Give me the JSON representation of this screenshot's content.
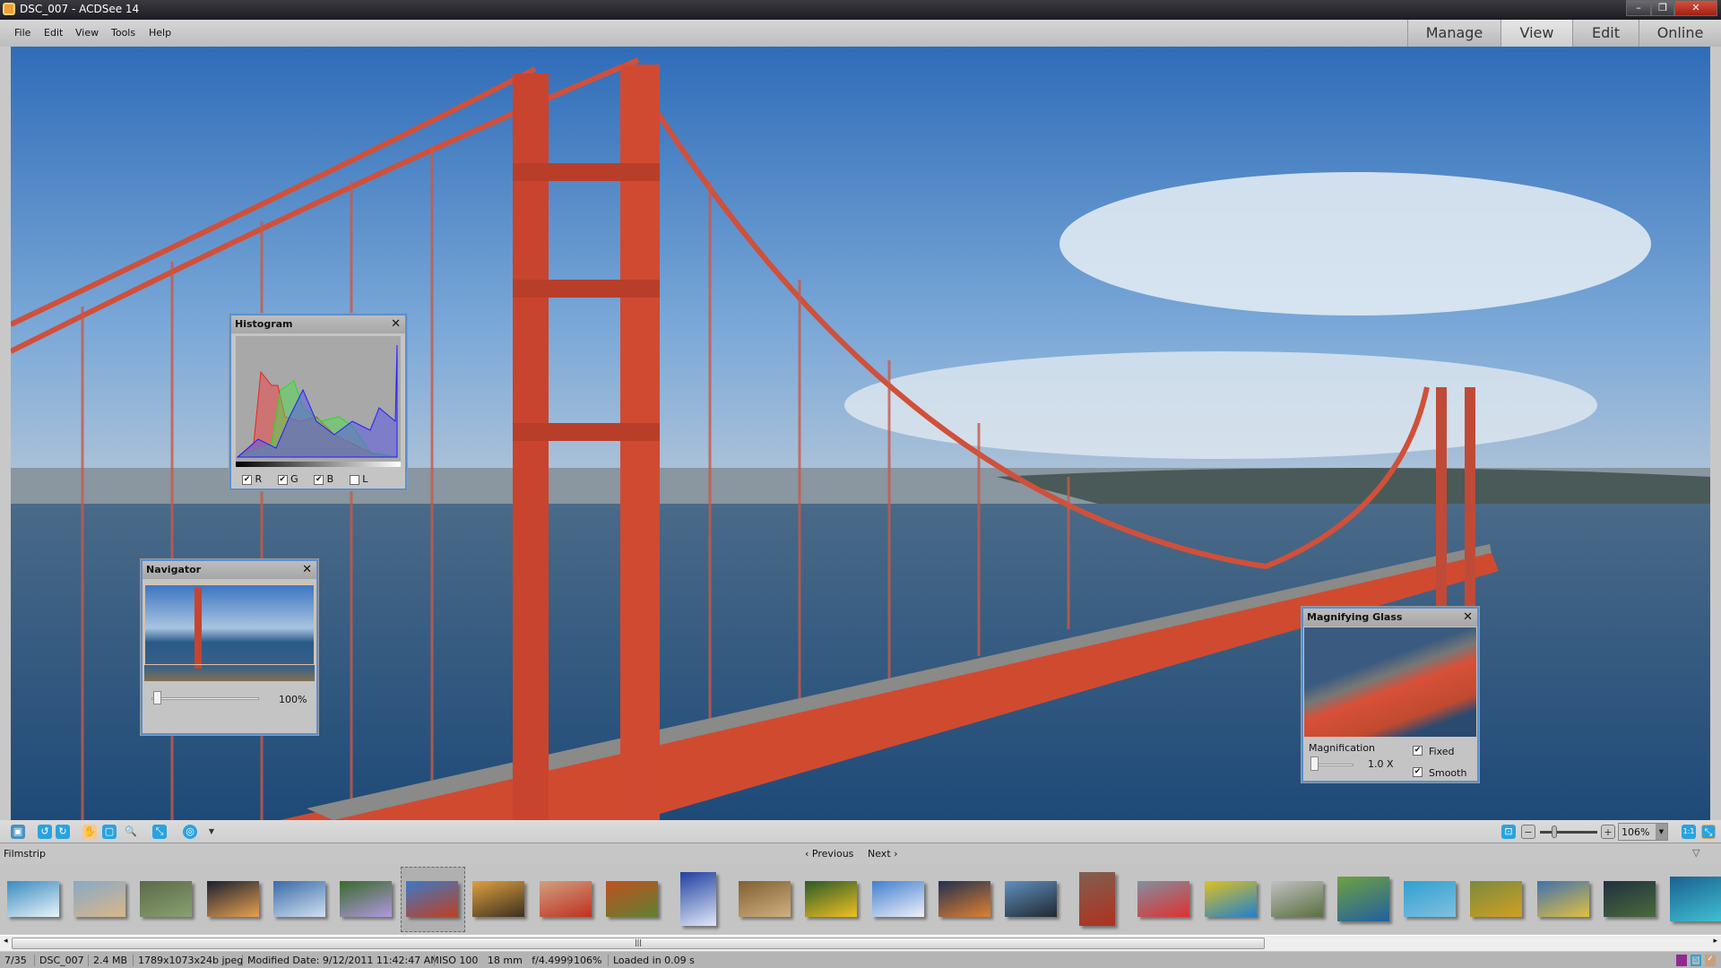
{
  "window": {
    "title": "DSC_007 - ACDSee 14",
    "minimize": "–",
    "maximize": "❐",
    "close": "✕"
  },
  "menu": [
    "File",
    "Edit",
    "View",
    "Tools",
    "Help"
  ],
  "modes": [
    {
      "label": "Manage",
      "active": false
    },
    {
      "label": "View",
      "active": true
    },
    {
      "label": "Edit",
      "active": false
    },
    {
      "label": "Online",
      "active": false
    }
  ],
  "histogram": {
    "title": "Histogram",
    "close": "✕",
    "channels": [
      {
        "label": "R",
        "checked": true,
        "color": "#ff3030"
      },
      {
        "label": "G",
        "checked": true,
        "color": "#30e030"
      },
      {
        "label": "B",
        "checked": true,
        "color": "#2020ff"
      },
      {
        "label": "L",
        "checked": false
      }
    ]
  },
  "navigator": {
    "title": "Navigator",
    "close": "✕",
    "zoom": "100%"
  },
  "magnifier": {
    "title": "Magnifying Glass",
    "close": "✕",
    "magnification_label": "Magnification",
    "value": "1.0  X",
    "fixed_label": "Fixed",
    "fixed": true,
    "smooth_label": "Smooth",
    "smooth": true
  },
  "toolbar": {
    "zoom_value": "106%",
    "actual_size": "1:1"
  },
  "filmstrip": {
    "label": "Filmstrip",
    "previous": "Previous",
    "next": "Next",
    "selected_index": 6,
    "thumb_colors": [
      [
        "#3a8ac0",
        "#e8f4f8"
      ],
      [
        "#88a8c8",
        "#d8b888"
      ],
      [
        "#5a6a4a",
        "#8aa070"
      ],
      [
        "#1a2030",
        "#e8a050"
      ],
      [
        "#3a6aa8",
        "#d0e0f0"
      ],
      [
        "#3a6a2a",
        "#b098e0"
      ],
      [
        "#3a7ac8",
        "#c04020"
      ],
      [
        "#e0a040",
        "#3a3020"
      ],
      [
        "#d0a080",
        "#c03020"
      ],
      [
        "#c05020",
        "#608030"
      ],
      [
        "#2040a0",
        "#e0e8f8"
      ],
      [
        "#806030",
        "#d0b080"
      ],
      [
        "#2a5a2a",
        "#f0c020"
      ],
      [
        "#4080d0",
        "#f0f0f8"
      ],
      [
        "#203050",
        "#e08030"
      ],
      [
        "#6090c0",
        "#202830"
      ],
      [
        "#806050",
        "#b03020"
      ],
      [
        "#8090a0",
        "#e03030"
      ],
      [
        "#e0c020",
        "#2080d0"
      ],
      [
        "#c0c0c0",
        "#5a7040"
      ],
      [
        "#70a040",
        "#2060a0"
      ],
      [
        "#30a0d0",
        "#80c0e0"
      ],
      [
        "#7a8a40",
        "#d0a020"
      ],
      [
        "#4070b0",
        "#e0c040"
      ],
      [
        "#203040",
        "#4a6a3a"
      ],
      [
        "#1a6090",
        "#40c0d0"
      ]
    ]
  },
  "status": {
    "index": "7/35",
    "name": "DSC_007",
    "size": "2.4 MB",
    "dims": "1789x1073x24b jpeg",
    "modified": "Modified Date: 9/12/2011 11:42:47 AM",
    "exif": "ISO 100   18 mm   f/4.4999",
    "zoom": "106%",
    "loaded": "Loaded in 0.09 s"
  }
}
